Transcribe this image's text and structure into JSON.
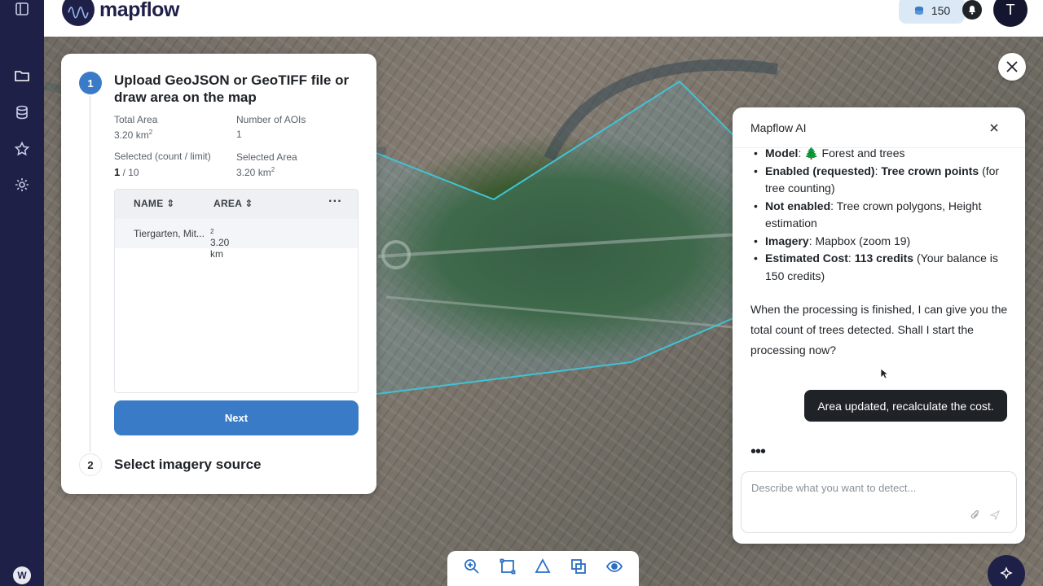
{
  "app": {
    "logo_text": "mapflow",
    "credits": "150",
    "avatar_initial": "T",
    "brand_color": "#1f2047",
    "accent_color": "#3a7bc8"
  },
  "rail": {
    "items": [
      "panel-toggle-icon",
      "folder-icon",
      "database-icon",
      "star-icon",
      "gear-icon"
    ],
    "bottom_logo": "W"
  },
  "panel": {
    "step1_number": "1",
    "step1_title": "Upload GeoJSON or GeoTIFF file or draw area on the map",
    "total_area_label": "Total Area",
    "total_area_value": "3.20 km",
    "aoi_count_label": "Number of AOIs",
    "aoi_count_value": "1",
    "selected_count_label": "Selected (count / limit)",
    "selected_count_value": "1",
    "selected_count_limit": " / 10",
    "selected_area_label": "Selected Area",
    "selected_area_value": "3.20 km",
    "area_unit_sup": "2",
    "table": {
      "col_name": "NAME",
      "col_area": "AREA",
      "more": "···",
      "rows": [
        {
          "name": "Tiergarten, Mit...",
          "area": "3.20 km"
        }
      ]
    },
    "next_label": "Next",
    "step2_number": "2",
    "step2_title": "Select imagery source"
  },
  "chat": {
    "title": "Mapflow AI",
    "bullets": [
      {
        "key": "Model",
        "rest": ": 🌲 Forest and trees"
      },
      {
        "key": "Enabled (requested)",
        "rest": ": ",
        "strong_rest": "Tree crown points",
        "tail": " (for tree counting)"
      },
      {
        "key": "Not enabled",
        "rest": ": Tree crown polygons, Height estimation"
      },
      {
        "key": "Imagery",
        "rest": ": Mapbox (zoom 19)"
      },
      {
        "key": "Estimated Cost",
        "rest": ": ",
        "strong_rest": "113 credits",
        "tail": " (Your balance is 150 credits)"
      }
    ],
    "assistant_message": "When the processing is finished, I can give you the total count of trees detected. Shall I start the processing now?",
    "user_message": "Area updated, recalculate the cost.",
    "typing_indicator": "•••",
    "input_placeholder": "Describe what you want to detect..."
  },
  "map_tools": [
    "zoom-icon",
    "rectangle-icon",
    "polygon-icon",
    "upload-shape-icon",
    "visibility-icon"
  ],
  "map_colors": {
    "aoi_outline": "#3fc4d6",
    "aoi_fill": "rgba(90,180,200,0.22)"
  }
}
